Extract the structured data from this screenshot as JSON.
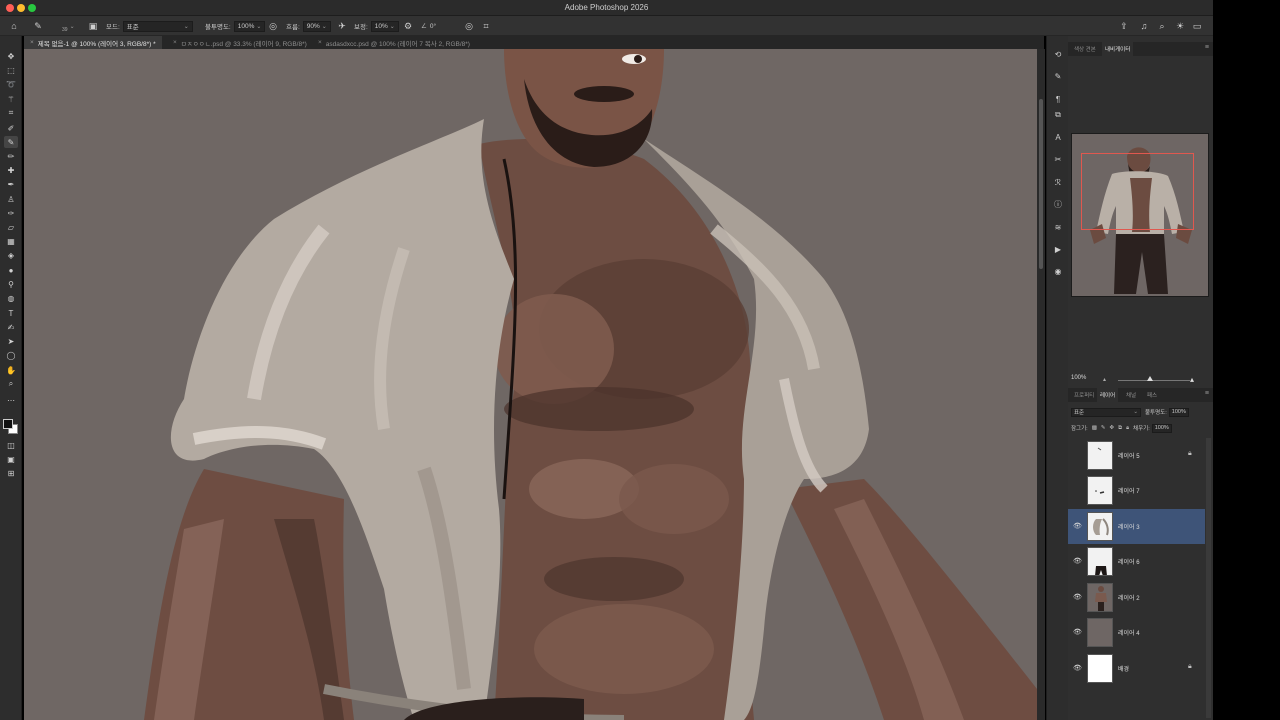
{
  "window": {
    "title": "Adobe Photoshop 2026"
  },
  "options_bar": {
    "brush_size": "39",
    "mode_label": "모드:",
    "mode_value": "표준",
    "opacity_label": "불투명도:",
    "opacity_value": "100%",
    "flow_label": "흐름:",
    "flow_value": "90%",
    "smoothing_label": "보정:",
    "smoothing_value": "10%",
    "angle_value": "0°"
  },
  "tabs": [
    {
      "label": "제목 없음-1 @ 100% (레이어 3, RGB/8*) *",
      "active": true
    },
    {
      "label": "ㅁㅈㅇㅇㄴ.psd @ 33.3% (레이어 9, RGB/8*)",
      "active": false
    },
    {
      "label": "asdasdxcc.psd @ 100% (레이어 7 복사 2, RGB/8*)",
      "active": false
    }
  ],
  "navigator": {
    "tabs": [
      "색상 견본",
      "내비게이터"
    ],
    "active_tab": "내비게이터",
    "zoom": "100%"
  },
  "layers_panel": {
    "tabs": [
      "프로퍼티",
      "레이어",
      "채널",
      "패스"
    ],
    "active_tab": "레이어",
    "blend_mode": "표준",
    "opacity_label": "불투명도:",
    "opacity_value": "100%",
    "lock_label": "잠그기:",
    "fill_label": "채우기:",
    "fill_value": "100%",
    "layers": [
      {
        "name": "레이어 5",
        "visible": false,
        "locked": true,
        "selected": false,
        "thumb": "sketch"
      },
      {
        "name": "레이어 7",
        "visible": false,
        "locked": false,
        "selected": false,
        "thumb": "sketch2"
      },
      {
        "name": "레이어 3",
        "visible": true,
        "locked": false,
        "selected": true,
        "thumb": "shirt"
      },
      {
        "name": "레이어 6",
        "visible": true,
        "locked": false,
        "selected": false,
        "thumb": "pants"
      },
      {
        "name": "레이어 2",
        "visible": true,
        "locked": false,
        "selected": false,
        "thumb": "body"
      },
      {
        "name": "레이어 4",
        "visible": true,
        "locked": false,
        "selected": false,
        "thumb": "grey"
      },
      {
        "name": "배경",
        "visible": true,
        "locked": true,
        "selected": false,
        "thumb": "white"
      }
    ]
  },
  "colors": {
    "canvas_bg": "#6f6764",
    "selected_layer": "#3e5478",
    "skin": "#7a5a4b",
    "shirt": "#b5aca3"
  }
}
